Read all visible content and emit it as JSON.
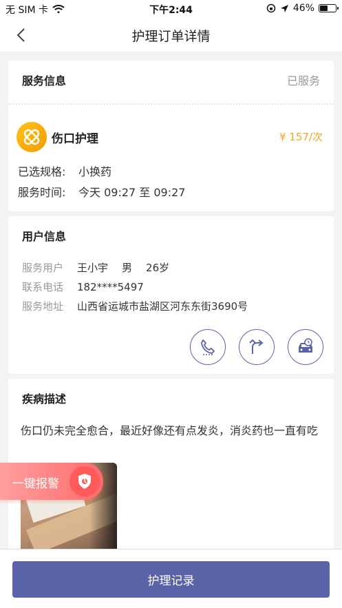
{
  "status_bar": {
    "carrier": "无 SIM 卡",
    "time": "下午2:44",
    "battery": "46%",
    "battery_level": 0.46
  },
  "nav": {
    "title": "护理订单详情"
  },
  "service": {
    "section_title": "服务信息",
    "status": "已服务",
    "name": "伤口护理",
    "price": "¥ 157/次",
    "spec_label": "已选规格:",
    "spec_value": "小换药",
    "time_label": "服务时间:",
    "time_value": "今天 09:27 至 09:27"
  },
  "user": {
    "section_title": "用户信息",
    "service_user_label": "服务用户",
    "name": "王小宇",
    "gender": "男",
    "age": "26岁",
    "phone_label": "联系电话",
    "phone": "182****5497",
    "address_label": "服务地址",
    "address": "山西省运城市盐湖区河东东街3690号"
  },
  "disease": {
    "section_title": "疾病描述",
    "description": "伤口仍未完全愈合，最近好像还有点发炎，消炎药也一直有吃"
  },
  "alarm": {
    "label": "一键报警"
  },
  "bottom": {
    "button_label": "护理记录"
  },
  "colors": {
    "primary": "#5a62a8",
    "price": "#f5a623",
    "alarm": "#ff6a6a"
  }
}
